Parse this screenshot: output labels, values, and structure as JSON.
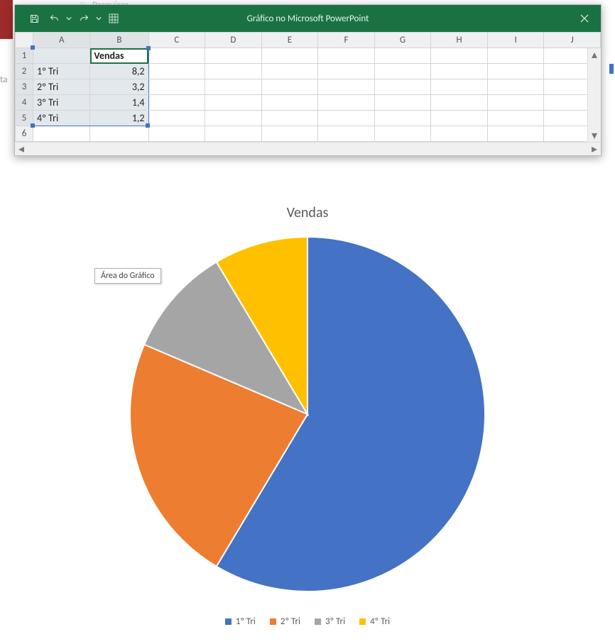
{
  "bg": {
    "search": "Pesquisar",
    "ta": "ta"
  },
  "window": {
    "title": "Gráfico no Microsoft PowerPoint"
  },
  "sheet": {
    "columns": [
      "A",
      "B",
      "C",
      "D",
      "E",
      "F",
      "G",
      "H",
      "I",
      "J"
    ],
    "rows": [
      "1",
      "2",
      "3",
      "4",
      "5",
      "6"
    ],
    "header_cell": "Vendas",
    "data": [
      {
        "label": "1º Tri",
        "value": "8,2"
      },
      {
        "label": "2º Tri",
        "value": "3,2"
      },
      {
        "label": "3º Tri",
        "value": "1,4"
      },
      {
        "label": "4º Tri",
        "value": "1,2"
      }
    ]
  },
  "chart_data": {
    "type": "pie",
    "title": "Vendas",
    "categories": [
      "1º Tri",
      "2º Tri",
      "3º Tri",
      "4º Tri"
    ],
    "values": [
      8.2,
      3.2,
      1.4,
      1.2
    ],
    "colors": [
      "#4472C4",
      "#ED7D31",
      "#A5A5A5",
      "#FFC000"
    ],
    "tooltip": "Área do Gráfico"
  }
}
